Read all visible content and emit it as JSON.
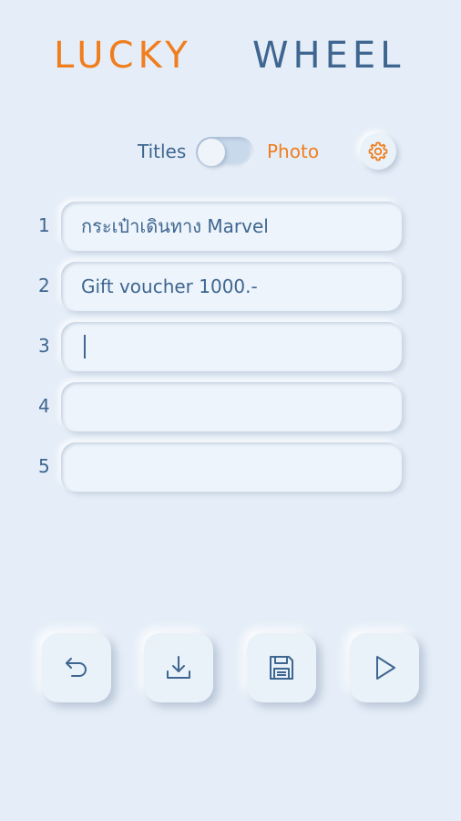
{
  "title": {
    "word1": "LUCKY",
    "word2": "WHEEL"
  },
  "mode_toggle": {
    "left_label": "Titles",
    "right_label": "Photo",
    "selected": "Titles"
  },
  "settings_icon": "gear-icon",
  "entries": [
    {
      "number": "1",
      "value": "กระเป๋าเดินทาง Marvel"
    },
    {
      "number": "2",
      "value": "Gift voucher 1000.-"
    },
    {
      "number": "3",
      "value": ""
    },
    {
      "number": "4",
      "value": ""
    },
    {
      "number": "5",
      "value": ""
    }
  ],
  "toolbar": {
    "icons": [
      "undo-icon",
      "download-icon",
      "save-icon",
      "play-icon"
    ]
  },
  "colors": {
    "accent": "#f07d1e",
    "primary": "#3f6690",
    "background": "#e5eef8"
  }
}
